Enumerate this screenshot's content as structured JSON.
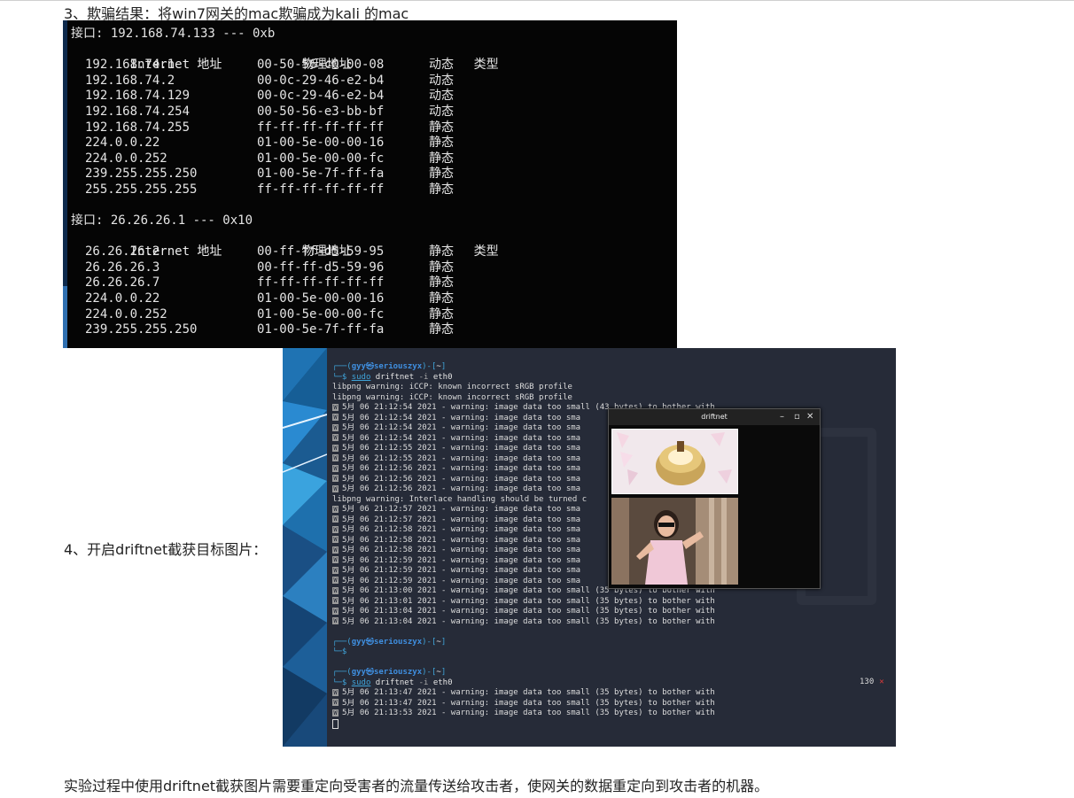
{
  "step3_text": "3、欺骗结果：将win7网关的mac欺骗成为kali 的mac",
  "step4_text": "4、开启driftnet截获目标图片：",
  "conclusion_text": "实验过程中使用driftnet截获图片需要重定向受害者的流量传送给攻击者，使网关的数据重定向到攻击者的机器。",
  "arp": {
    "interfaces": [
      {
        "header": "接口: 192.168.74.133 --- 0xb",
        "columns": [
          "Internet 地址",
          "物理地址",
          "类型"
        ],
        "rows": [
          [
            "192.168.74.1",
            "00-50-56-c0-00-08",
            "动态"
          ],
          [
            "192.168.74.2",
            "00-0c-29-46-e2-b4",
            "动态"
          ],
          [
            "192.168.74.129",
            "00-0c-29-46-e2-b4",
            "动态"
          ],
          [
            "192.168.74.254",
            "00-50-56-e3-bb-bf",
            "动态"
          ],
          [
            "192.168.74.255",
            "ff-ff-ff-ff-ff-ff",
            "静态"
          ],
          [
            "224.0.0.22",
            "01-00-5e-00-00-16",
            "静态"
          ],
          [
            "224.0.0.252",
            "01-00-5e-00-00-fc",
            "静态"
          ],
          [
            "239.255.255.250",
            "01-00-5e-7f-ff-fa",
            "静态"
          ],
          [
            "255.255.255.255",
            "ff-ff-ff-ff-ff-ff",
            "静态"
          ]
        ]
      },
      {
        "header": "接口: 26.26.26.1 --- 0x10",
        "columns": [
          "Internet 地址",
          "物理地址",
          "类型"
        ],
        "rows": [
          [
            "26.26.26.2",
            "00-ff-ff-d5-59-95",
            "静态"
          ],
          [
            "26.26.26.3",
            "00-ff-ff-d5-59-96",
            "静态"
          ],
          [
            "26.26.26.7",
            "ff-ff-ff-ff-ff-ff",
            "静态"
          ],
          [
            "224.0.0.22",
            "01-00-5e-00-00-16",
            "静态"
          ],
          [
            "224.0.0.252",
            "01-00-5e-00-00-fc",
            "静态"
          ],
          [
            "239.255.255.250",
            "01-00-5e-7f-ff-fa",
            "静态"
          ]
        ]
      }
    ]
  },
  "terminal": {
    "prompt_user": "gyy㉿seriouszyx",
    "prompt_dir": "~",
    "cmd_sudo": "sudo",
    "cmd_rest": "driftnet",
    "cmd_flag": "-i",
    "cmd_iface": "eth0",
    "warn1": "libpng warning: iCCP: known incorrect sRGB profile",
    "warn2": "libpng warning: iCCP: known incorrect sRGB profile",
    "warn_interlace": "libpng warning: Interlace handling should be turned c",
    "month": "5月",
    "msg": "06 21:12:54 2021 - warning: image data too sma",
    "lines_a": [
      "06 21:12:54 2021 - warning: image data too small (43 bytes) to bother with",
      "06 21:12:54 2021 - warning: image data too sma",
      "06 21:12:54 2021 - warning: image data too sma",
      "06 21:12:54 2021 - warning: image data too sma",
      "06 21:12:55 2021 - warning: image data too sma",
      "06 21:12:55 2021 - warning: image data too sma",
      "06 21:12:56 2021 - warning: image data too sma",
      "06 21:12:56 2021 - warning: image data too sma",
      "06 21:12:56 2021 - warning: image data too sma"
    ],
    "lines_b": [
      "06 21:12:57 2021 - warning: image data too sma",
      "06 21:12:57 2021 - warning: image data too sma",
      "06 21:12:58 2021 - warning: image data too sma",
      "06 21:12:58 2021 - warning: image data too sma",
      "06 21:12:58 2021 - warning: image data too sma",
      "06 21:12:59 2021 - warning: image data too sma",
      "06 21:12:59 2021 - warning: image data too sma",
      "06 21:12:59 2021 - warning: image data too sma",
      "06 21:13:00 2021 - warning: image data too small (35 bytes) to bother with",
      "06 21:13:01 2021 - warning: image data too small (35 bytes) to bother with",
      "06 21:13:04 2021 - warning: image data too small (35 bytes) to bother with",
      "06 21:13:04 2021 - warning: image data too small (35 bytes) to bother with"
    ],
    "lines_c": [
      "06 21:13:47 2021 - warning: image data too small (35 bytes) to bother with",
      "06 21:13:47 2021 - warning: image data too small (35 bytes) to bother with",
      "06 21:13:53 2021 - warning: image data too small (35 bytes) to bother with"
    ],
    "return_code": "130",
    "return_mark": "✕"
  },
  "driftnet_window": {
    "title": "driftnet",
    "min": "–",
    "max": "▫",
    "close": "✕"
  },
  "colors": {
    "terminal_bg": "#262b38",
    "prompt": "#3fa3d8",
    "error_mark": "#e03a3a"
  }
}
